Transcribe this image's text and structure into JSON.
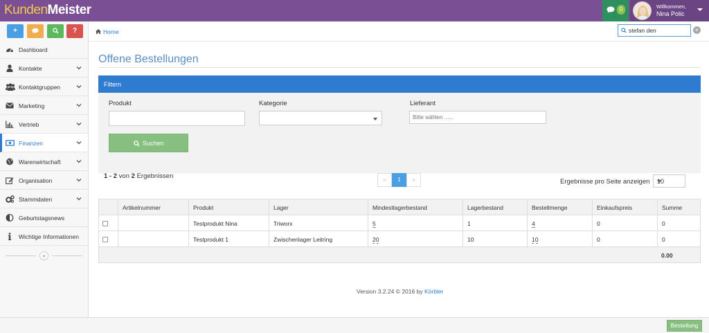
{
  "app": {
    "logo_part1": "Kunden",
    "logo_part2": "Meister",
    "message_count": "0",
    "welcome": "Willkommen,",
    "user_name": "Nina Polic",
    "colors": {
      "topbar": "#7a4f93",
      "accent": "#2e7bcf",
      "success": "#86bf7f"
    }
  },
  "quick_buttons": [
    {
      "icon": "plus-icon",
      "label": "+",
      "color": "#4a9fe3"
    },
    {
      "icon": "chat-icon",
      "label": "",
      "color": "#f0ad4e"
    },
    {
      "icon": "search-icon",
      "label": "",
      "color": "#5cb85c"
    },
    {
      "icon": "help-icon",
      "label": "?",
      "color": "#d9534f"
    }
  ],
  "sidebar": {
    "items": [
      {
        "label": "Dashboard",
        "icon": "dashboard-icon",
        "has_submenu": false
      },
      {
        "label": "Kontakte",
        "icon": "user-icon",
        "has_submenu": true
      },
      {
        "label": "Kontaktgruppen",
        "icon": "users-icon",
        "has_submenu": true
      },
      {
        "label": "Marketing",
        "icon": "envelope-icon",
        "has_submenu": true
      },
      {
        "label": "Vertrieb",
        "icon": "bar-chart-icon",
        "has_submenu": true
      },
      {
        "label": "Finanzen",
        "icon": "money-icon",
        "has_submenu": true,
        "active": true
      },
      {
        "label": "Warenwirtschaft",
        "icon": "globe-icon",
        "has_submenu": true
      },
      {
        "label": "Organisation",
        "icon": "edit-icon",
        "has_submenu": true
      },
      {
        "label": "Stammdaten",
        "icon": "cogs-icon",
        "has_submenu": true
      },
      {
        "label": "Geburtstagsnews",
        "icon": "half-circle-icon",
        "has_submenu": false
      },
      {
        "label": "Wichtige Informationen",
        "icon": "info-icon",
        "has_submenu": false
      }
    ],
    "collapse_label": "«"
  },
  "breadcrumb": {
    "home": "Home"
  },
  "search": {
    "value": "stefan den",
    "clear": "×"
  },
  "page": {
    "title": "Offene Bestellungen"
  },
  "filter": {
    "header": "Filtern",
    "produkt_label": "Produkt",
    "produkt_value": "",
    "kategorie_label": "Kategorie",
    "kategorie_value": "",
    "lieferant_label": "Lieferant",
    "lieferant_placeholder": "Bitte wählen ......",
    "search_button": "Suchen"
  },
  "results": {
    "range": "1 - 2",
    "von": "von",
    "total": "2",
    "suffix": "Ergebnissen"
  },
  "pager": {
    "prev": "«",
    "current": "1",
    "next": "»"
  },
  "per_page": {
    "label": "Ergebnisse pro Seite anzeigen",
    "value": "10"
  },
  "table": {
    "columns": [
      "",
      "Artikelnummer",
      "Produkt",
      "Lager",
      "Mindestlagerbestand",
      "Lagerbestand",
      "Bestellmenge",
      "Einkaufspreis",
      "Summe"
    ],
    "rows": [
      {
        "artikelnummer": "",
        "produkt": "Testprodukt Nina",
        "lager": "Triworx",
        "mindest": "5",
        "lagerbestand": "1",
        "bestellmenge": "4",
        "einkaufspreis": "0",
        "summe": "0"
      },
      {
        "artikelnummer": "",
        "produkt": "Testprodukt 1",
        "lager": "Zwischenlager Leitring",
        "mindest": "20",
        "lagerbestand": "10",
        "bestellmenge": "10",
        "einkaufspreis": "0",
        "summe": "0"
      }
    ],
    "total_sum": "0.00"
  },
  "footer": {
    "version": "Version 3.2.24 © 2016 by",
    "company": "Körbler"
  },
  "bottom": {
    "order_button": "Bestellung"
  }
}
